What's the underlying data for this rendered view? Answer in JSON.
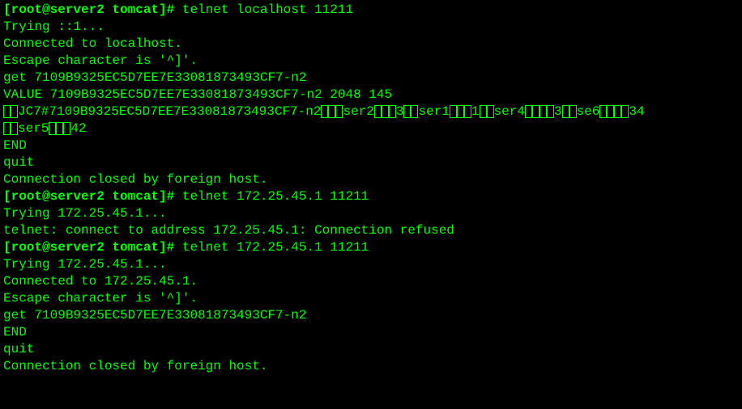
{
  "lines": [
    {
      "segments": [
        {
          "t": "[root@server2 tomcat]# ",
          "bold": true
        },
        {
          "t": "telnet localhost 11211"
        }
      ]
    },
    {
      "segments": [
        {
          "t": "Trying ::1..."
        }
      ]
    },
    {
      "segments": [
        {
          "t": "Connected to localhost."
        }
      ]
    },
    {
      "segments": [
        {
          "t": "Escape character is '^]'."
        }
      ]
    },
    {
      "segments": [
        {
          "t": "get 7109B9325EC5D7EE7E33081873493CF7-n2"
        }
      ]
    },
    {
      "segments": [
        {
          "t": "VALUE 7109B9325EC5D7EE7E33081873493CF7-n2 2048 145"
        }
      ]
    },
    {
      "segments": [
        {
          "t": "",
          "boxes": 2
        },
        {
          "t": "JC7#7109B9325EC5D7EE7E33081873493CF7-n2"
        },
        {
          "t": "",
          "boxes": 3
        },
        {
          "t": "ser2"
        },
        {
          "t": "",
          "boxes": 3
        },
        {
          "t": "3"
        },
        {
          "t": "",
          "boxes": 2
        },
        {
          "t": "ser1"
        },
        {
          "t": "",
          "boxes": 3
        },
        {
          "t": "1"
        },
        {
          "t": "",
          "boxes": 2
        },
        {
          "t": "ser4"
        },
        {
          "t": "",
          "boxes": 4
        },
        {
          "t": "3"
        },
        {
          "t": "",
          "boxes": 2
        },
        {
          "t": "se6"
        },
        {
          "t": "",
          "boxes": 4
        },
        {
          "t": "34"
        }
      ]
    },
    {
      "segments": [
        {
          "t": "",
          "boxes": 2
        },
        {
          "t": "ser5"
        },
        {
          "t": "",
          "boxes": 3
        },
        {
          "t": "42"
        }
      ]
    },
    {
      "segments": [
        {
          "t": "END"
        }
      ]
    },
    {
      "segments": [
        {
          "t": "quit"
        }
      ]
    },
    {
      "segments": [
        {
          "t": "Connection closed by foreign host."
        }
      ]
    },
    {
      "segments": [
        {
          "t": "[root@server2 tomcat]# ",
          "bold": true
        },
        {
          "t": "telnet 172.25.45.1 11211"
        }
      ]
    },
    {
      "segments": [
        {
          "t": "Trying 172.25.45.1..."
        }
      ]
    },
    {
      "segments": [
        {
          "t": "telnet: connect to address 172.25.45.1: Connection refused"
        }
      ]
    },
    {
      "segments": [
        {
          "t": "[root@server2 tomcat]# ",
          "bold": true
        },
        {
          "t": "telnet 172.25.45.1 11211"
        }
      ]
    },
    {
      "segments": [
        {
          "t": "Trying 172.25.45.1..."
        }
      ]
    },
    {
      "segments": [
        {
          "t": "Connected to 172.25.45.1."
        }
      ]
    },
    {
      "segments": [
        {
          "t": "Escape character is '^]'."
        }
      ]
    },
    {
      "segments": [
        {
          "t": "get 7109B9325EC5D7EE7E33081873493CF7-n2"
        }
      ]
    },
    {
      "segments": [
        {
          "t": "END"
        }
      ]
    },
    {
      "segments": [
        {
          "t": "quit"
        }
      ]
    },
    {
      "segments": [
        {
          "t": "Connection closed by foreign host."
        }
      ]
    }
  ]
}
